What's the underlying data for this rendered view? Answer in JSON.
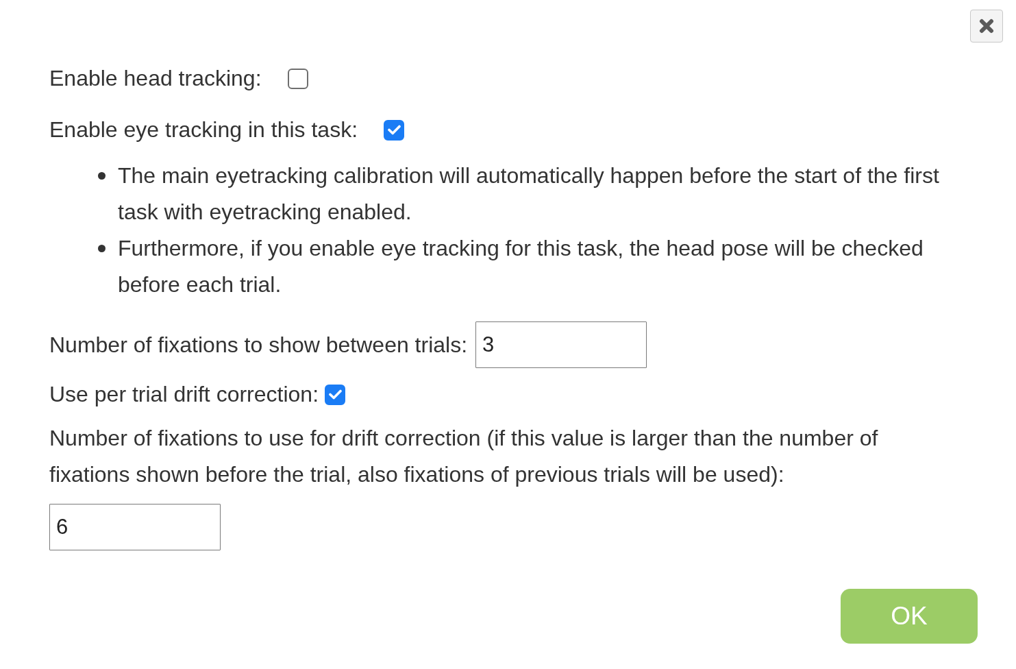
{
  "dialog": {
    "close_button": true
  },
  "tracking_options": [
    {
      "label": "Enable head tracking:",
      "checked": false
    },
    {
      "label": "Enable eye tracking in this task:",
      "checked": true,
      "notes": [
        "The main eyetracking calibration will automatically happen before the start of the first task with eyetracking enabled.",
        "Furthermore, if you enable eye tracking for this task, the head pose will be checked before each trial."
      ]
    }
  ],
  "settings": [
    {
      "kind": "input",
      "label": "Number of fixations to show between trials:",
      "value": "3"
    },
    {
      "kind": "checkbox",
      "label": "Use per trial drift correction:",
      "checked": true
    },
    {
      "kind": "block",
      "label": "Number of fixations to use for drift correction (if this value is larger than the number of fixations shown before the trial, also fixations of previous trials will be used):",
      "value": "6"
    }
  ],
  "buttons": [
    {
      "label": "OK"
    }
  ]
}
